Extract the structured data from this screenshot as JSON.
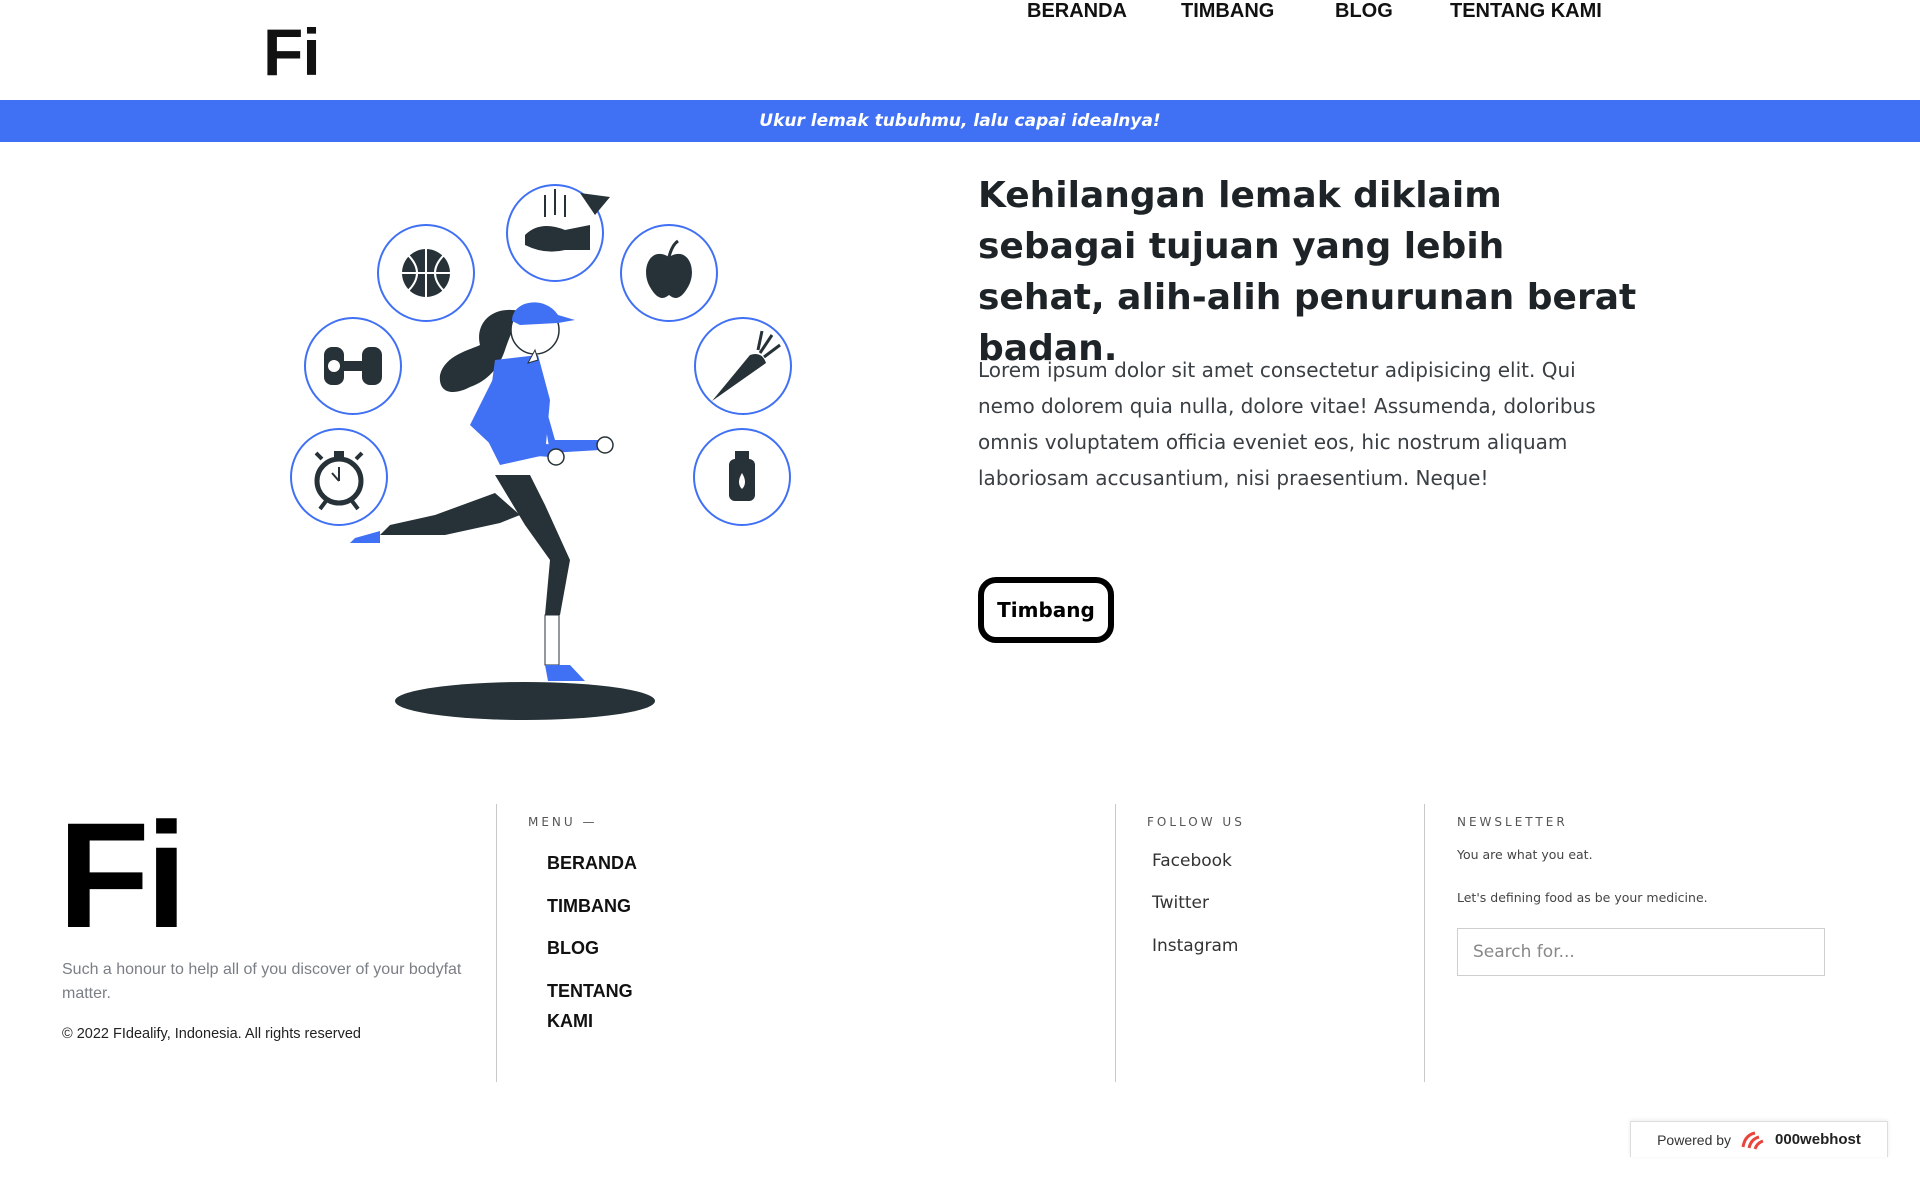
{
  "header": {
    "logo": "Fi",
    "nav": [
      "BERANDA",
      "TIMBANG",
      "BLOG",
      "TENTANG KAMI"
    ]
  },
  "banner": {
    "text": "Ukur lemak tubuhmu, lalu capai idealnya!"
  },
  "hero": {
    "title": "Kehilangan lemak diklaim sebagai tujuan yang lebih sehat, alih-alih penurunan berat badan.",
    "body": "Lorem ipsum dolor sit amet consectetur adipisicing elit. Qui nemo dolorem quia nulla, dolore vitae! Assumenda, doloribus omnis voluptatem officia eveniet eos, hic nostrum aliquam laboriosam accusantium, nisi praesentium. Neque!",
    "button": "Timbang"
  },
  "footer": {
    "logo": "Fi",
    "tagline": "Such a honour to help all of you discover of your bodyfat matter.",
    "copyright": "© 2022 FIdealify, Indonesia. All rights reserved",
    "menu_heading": "MENU —",
    "menu": [
      "BERANDA",
      "TIMBANG",
      "BLOG",
      "TENTANG KAMI"
    ],
    "follow_heading": "FOLLOW US",
    "follow": [
      "Facebook",
      "Twitter",
      "Instagram"
    ],
    "newsletter_heading": "NEWSLETTER",
    "newsletter_line1": "You are what you eat.",
    "newsletter_line2": "Let's defining food as be your medicine.",
    "search_placeholder": "Search for..."
  },
  "powered_by": {
    "label": "Powered by",
    "brand": "000webhost"
  },
  "colors": {
    "accent": "#4070f4",
    "dark": "#263238"
  }
}
